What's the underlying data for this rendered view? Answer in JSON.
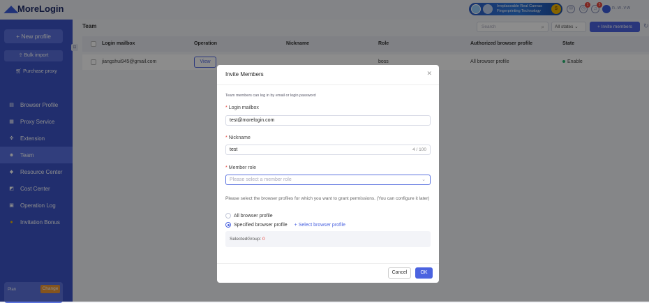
{
  "app": {
    "name": "MoreLogin"
  },
  "topbar": {
    "banner_line1": "Irreplaceable Real Canvas",
    "banner_line2": "Fingerprinting Technology",
    "notif1_badge": "1",
    "notif2_badge": "5",
    "user": "n.w.vw"
  },
  "sidebar": {
    "new_profile": "+ New profile",
    "bulk_import": "Bulk import",
    "purchase_proxy": "Purchase proxy",
    "items": [
      {
        "label": "Browser Profile"
      },
      {
        "label": "Proxy Service"
      },
      {
        "label": "Extension"
      },
      {
        "label": "Team"
      },
      {
        "label": "Resource Center"
      },
      {
        "label": "Cost Center"
      },
      {
        "label": "Operation Log"
      },
      {
        "label": "Invitation Bonus"
      }
    ],
    "plan_label": "Plan",
    "plan_change": "Change"
  },
  "main": {
    "title": "Team",
    "search_placeholder": "Search",
    "states_select": "All states",
    "invite_button": "+ Invite members",
    "columns": [
      "Login mailbox",
      "Operation",
      "Nickname",
      "Role",
      "Authorized browser profile",
      "State"
    ],
    "rows": [
      {
        "mailbox": "jiangshui945@gmail.com",
        "operation": "View",
        "nickname": "",
        "role": "boss",
        "authorized": "All browser profile",
        "state": "Enable"
      }
    ]
  },
  "modal": {
    "title": "Invite Members",
    "hint": "Team members can log in by email or login password",
    "mailbox_label": "Login mailbox",
    "mailbox_value": "test@morelogin.com",
    "nickname_label": "Nickname",
    "nickname_value": "test",
    "nickname_count": "4 / 100",
    "role_label": "Member role",
    "role_placeholder": "Please select a member role",
    "permission_text": "Please select the browser profiles for which you want to grant permissions. (You can configure it later)",
    "option_all": "All browser profile",
    "option_specified": "Specified browser profile",
    "select_link": "+ Select browser profile",
    "selected_group_label": "SelectedGroup: ",
    "selected_group_count": "0",
    "cancel": "Cancel",
    "ok": "OK"
  },
  "colors": {
    "accent": "#4b63e0",
    "sidebar": "#3d55c9",
    "required": "#e8453c",
    "enabled": "#2bb673"
  }
}
